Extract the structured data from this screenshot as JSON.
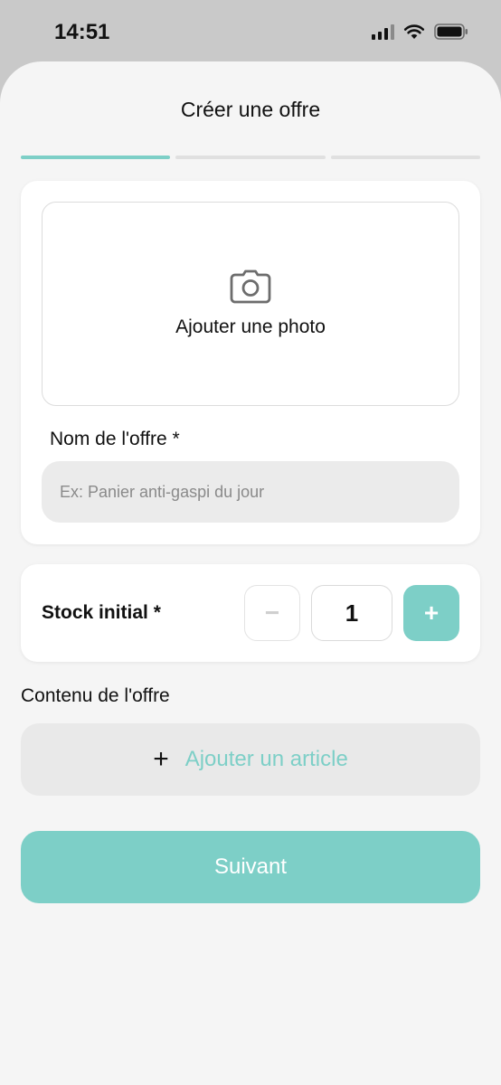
{
  "status_bar": {
    "time": "14:51",
    "signal_icon": "cellular-signal-icon",
    "wifi_icon": "wifi-icon",
    "battery_icon": "battery-icon"
  },
  "header": {
    "title": "Créer une offre"
  },
  "progress": {
    "steps": 3,
    "current_step": 1,
    "active_color": "#7dcfc7"
  },
  "photo": {
    "label": "Ajouter une photo",
    "icon": "camera-icon"
  },
  "offer_name": {
    "label": "Nom de l'offre *",
    "value": "",
    "placeholder": "Ex: Panier anti-gaspi du jour"
  },
  "stock": {
    "label": "Stock initial *",
    "minus": "−",
    "value": "1",
    "plus": "+"
  },
  "content": {
    "title": "Contenu de l'offre",
    "add_icon": "+",
    "add_label": "Ajouter un article"
  },
  "footer": {
    "next_label": "Suivant"
  },
  "colors": {
    "accent": "#7dcfc7",
    "background": "#f5f5f5",
    "card": "#ffffff"
  }
}
